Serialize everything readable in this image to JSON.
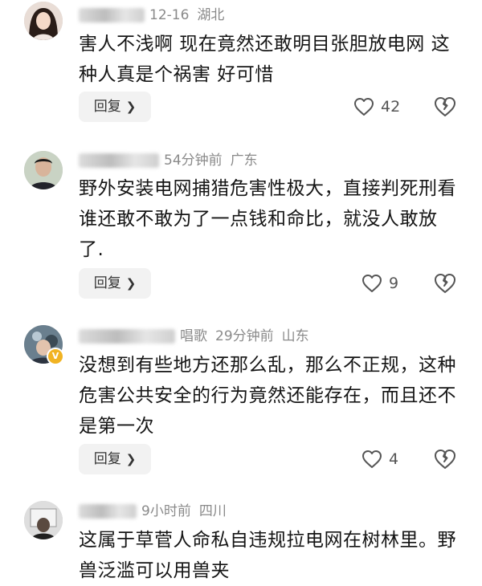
{
  "comments": [
    {
      "time": "12-16",
      "location": "湖北",
      "text": "害人不浅啊 现在竟然还敢明目张胆放电网 这种人真是个祸害 好可惜",
      "reply_label": "回复",
      "likes": "42"
    },
    {
      "time": "54分钟前",
      "location": "广东",
      "text": "野外安装电网捕猎危害性极大，直接判死刑看谁还敢不敢为了一点钱和命比，就没人敢放了.",
      "reply_label": "回复",
      "likes": "9"
    },
    {
      "name_visible": "唱歌",
      "time": "29分钟前",
      "location": "山东",
      "text": "没想到有些地方还那么乱，那么不正规，这种危害公共安全的行为竟然还能存在，而且还不是第一次",
      "reply_label": "回复",
      "likes": "4"
    },
    {
      "time": "9小时前",
      "location": "四川",
      "text": "这属于草菅人命私自违规拉电网在树林里。野兽泛滥可以用兽夹"
    }
  ],
  "icons": {
    "like": "heart-outline-icon",
    "dislike": "broken-heart-icon",
    "chevron": "chevron-right-icon",
    "verified": "verified-badge-icon"
  },
  "colors": {
    "text": "#151515",
    "meta": "#8a8a8a",
    "reply_bg": "#f2f2f2",
    "icon": "#555555",
    "badge": "#f1b322"
  }
}
